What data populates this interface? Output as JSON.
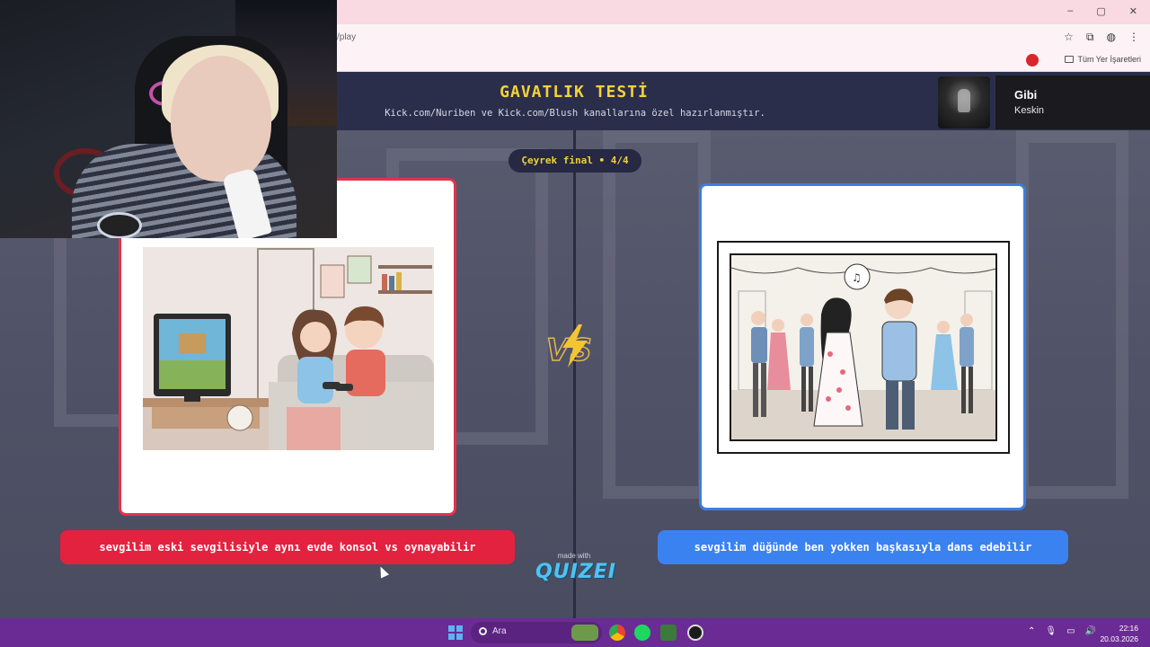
{
  "browser": {
    "url": "/play",
    "bookmarks_label": "Tüm Yer İşaretleri",
    "window_controls": [
      "–",
      "▢",
      "✕"
    ]
  },
  "quiz": {
    "title": "GAVATLIK TESTİ",
    "subtitle": "Kick.com/Nuriben ve Kick.com/Blush kanallarına özel hazırlanmıştır.",
    "round": "Çeyrek final • 4/4",
    "option_left": "sevgilim eski sevgilisiyle aynı evde konsol vs oynayabilir",
    "option_right": "sevgilim düğünde ben yokken başkasıyla dans edebilir",
    "vs_label": "VS",
    "made_with": "made with",
    "brand": "QUIZEI"
  },
  "now_playing": {
    "song": "Gibi",
    "artist": "Keskin"
  },
  "taskbar": {
    "search_placeholder": "Ara",
    "time": "22:16",
    "date": "20.03.2026"
  },
  "colors": {
    "left_accent": "#e3223f",
    "right_accent": "#3a82f0",
    "title_yellow": "#f4d23a",
    "taskbar": "#6b2b94"
  }
}
